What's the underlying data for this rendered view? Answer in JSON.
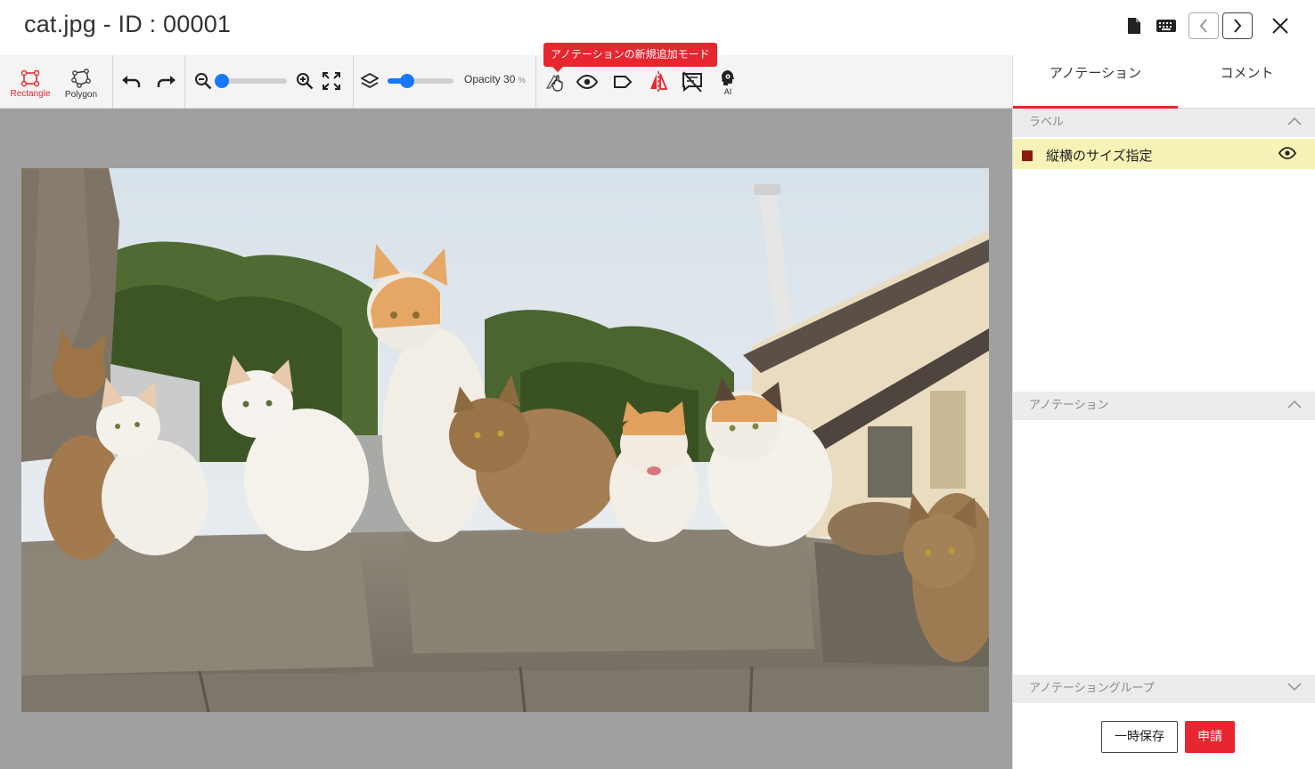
{
  "window": {
    "title": "cat.jpg - ID : 00001"
  },
  "toolbar": {
    "rectangle_label": "Rectangle",
    "polygon_label": "Polygon",
    "zoom_level": 0.02,
    "opacity_label": "Opacity 30",
    "opacity_unit": "%",
    "opacity_value": 0.3,
    "tooltip": "アノテーションの新規追加モード",
    "ai_label": "AI"
  },
  "panel": {
    "tabs": [
      {
        "label": "アノテーション"
      },
      {
        "label": "コメント"
      }
    ],
    "sections": {
      "labels": "ラベル",
      "annotations": "アノテーション",
      "groups": "アノテーショングループ"
    },
    "label_items": [
      {
        "name": "縦横のサイズ指定",
        "color": "#8b1a10"
      }
    ],
    "save_label": "一時保存",
    "submit_label": "申請"
  },
  "colors": {
    "accent": "#e8262f",
    "slider": "#1677ff",
    "label_highlight": "#f7f3b6"
  }
}
